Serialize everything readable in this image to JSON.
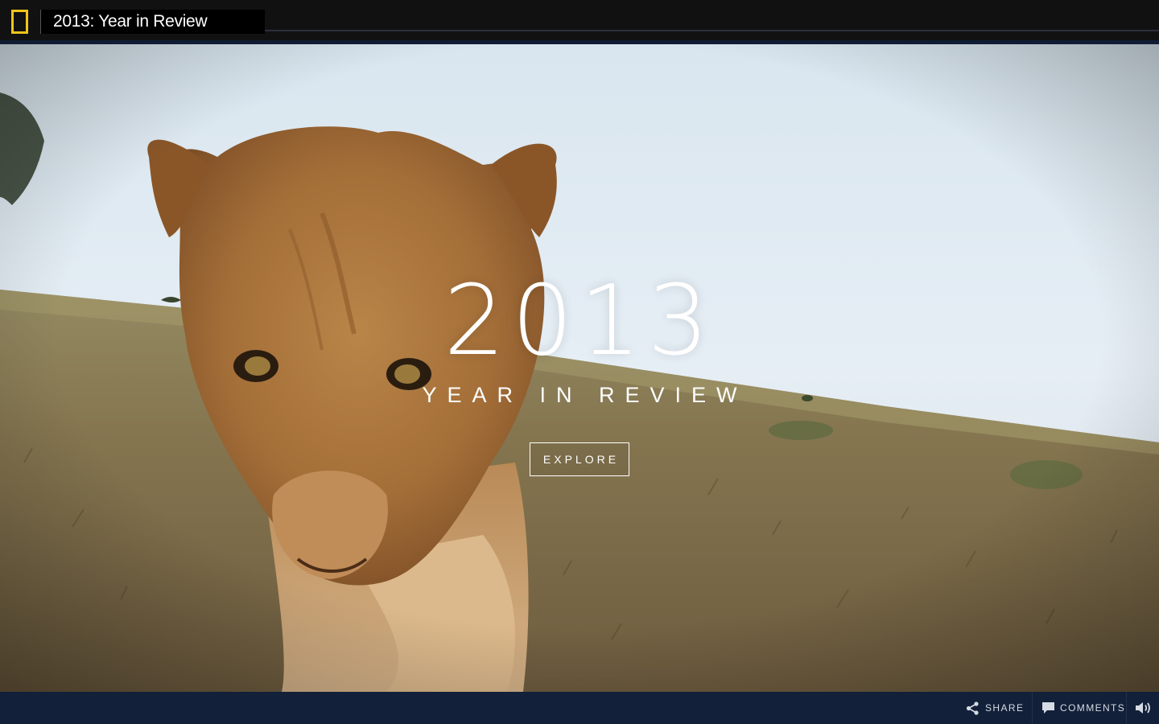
{
  "header": {
    "title": "2013: Year in Review",
    "logo_icon": "yellow-border-icon",
    "logo_color": "#f0c419",
    "background": "#111111"
  },
  "hero": {
    "year": "2013",
    "subtitle": "YEAR IN REVIEW",
    "explore_label": "EXPLORE",
    "scene": "lion-cub-in-savanna"
  },
  "footer": {
    "share_label": "SHARE",
    "share_icon": "share-icon",
    "comments_label": "COMMENTS",
    "comments_icon": "comment-icon",
    "sound_icon": "volume-icon",
    "background": "#122039"
  }
}
